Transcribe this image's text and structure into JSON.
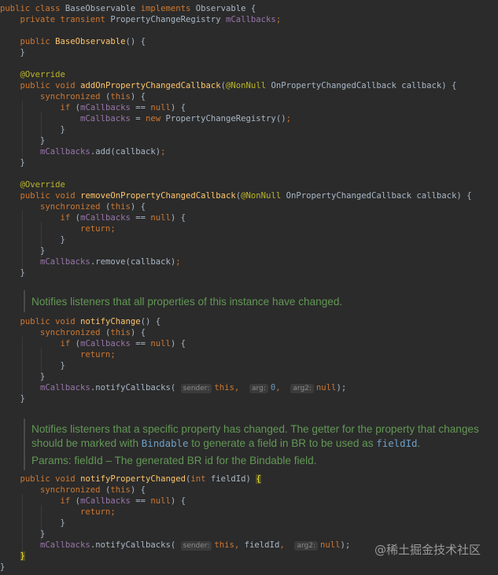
{
  "code": {
    "l1": [
      [
        "public class ",
        "kw"
      ],
      [
        "BaseObservable ",
        "plain"
      ],
      [
        "implements ",
        "kw"
      ],
      [
        "Observable {",
        "plain"
      ]
    ],
    "l2": [
      [
        "    private transient ",
        "kw"
      ],
      [
        "PropertyChangeRegistry ",
        "plain"
      ],
      [
        "mCallbacks",
        "fld"
      ],
      [
        ";",
        "kw"
      ]
    ],
    "l3": [
      [
        "    public ",
        "kw"
      ],
      [
        "BaseObservable",
        "fn"
      ],
      [
        "() {",
        "plain"
      ]
    ],
    "l4": [
      [
        "    }",
        "plain"
      ]
    ],
    "l5": [
      [
        "    @Override",
        "ann"
      ]
    ],
    "l6": [
      [
        "    public void ",
        "kw"
      ],
      [
        "addOnPropertyChangedCallback",
        "fn"
      ],
      [
        "(",
        "plain"
      ],
      [
        "@NonNull ",
        "ann"
      ],
      [
        "OnPropertyChangedCallback callback) {",
        "plain"
      ]
    ],
    "l7": [
      [
        "        synchronized ",
        "kw"
      ],
      [
        "(",
        "plain"
      ],
      [
        "this",
        "kw"
      ],
      [
        ") {",
        "plain"
      ]
    ],
    "l8": [
      [
        "            if ",
        "kw"
      ],
      [
        "(",
        "plain"
      ],
      [
        "mCallbacks ",
        "fld"
      ],
      [
        "== ",
        "plain"
      ],
      [
        "null",
        "kw"
      ],
      [
        ") {",
        "plain"
      ]
    ],
    "l9": [
      [
        "                mCallbacks ",
        "fld"
      ],
      [
        "= ",
        "plain"
      ],
      [
        "new ",
        "kw"
      ],
      [
        "PropertyChangeRegistry",
        "plain"
      ],
      [
        "()",
        "plain"
      ],
      [
        ";",
        "kw"
      ]
    ],
    "l10": [
      [
        "            }",
        "plain"
      ]
    ],
    "l11": [
      [
        "        }",
        "plain"
      ]
    ],
    "l12": [
      [
        "        mCallbacks",
        "fld"
      ],
      [
        ".add(callback)",
        "plain"
      ],
      [
        ";",
        "kw"
      ]
    ],
    "l13": [
      [
        "    }",
        "plain"
      ]
    ],
    "l14": [
      [
        "    @Override",
        "ann"
      ]
    ],
    "l15": [
      [
        "    public void ",
        "kw"
      ],
      [
        "removeOnPropertyChangedCallback",
        "fn"
      ],
      [
        "(",
        "plain"
      ],
      [
        "@NonNull ",
        "ann"
      ],
      [
        "OnPropertyChangedCallback callback) {",
        "plain"
      ]
    ],
    "l16": [
      [
        "        synchronized ",
        "kw"
      ],
      [
        "(",
        "plain"
      ],
      [
        "this",
        "kw"
      ],
      [
        ") {",
        "plain"
      ]
    ],
    "l17": [
      [
        "            if ",
        "kw"
      ],
      [
        "(",
        "plain"
      ],
      [
        "mCallbacks ",
        "fld"
      ],
      [
        "== ",
        "plain"
      ],
      [
        "null",
        "kw"
      ],
      [
        ") {",
        "plain"
      ]
    ],
    "l18": [
      [
        "                return",
        "kw"
      ],
      [
        ";",
        "kw"
      ]
    ],
    "l19": [
      [
        "            }",
        "plain"
      ]
    ],
    "l20": [
      [
        "        }",
        "plain"
      ]
    ],
    "l21": [
      [
        "        mCallbacks",
        "fld"
      ],
      [
        ".remove(callback)",
        "plain"
      ],
      [
        ";",
        "kw"
      ]
    ],
    "l22": [
      [
        "    }",
        "plain"
      ]
    ],
    "l23": [
      [
        "    public void ",
        "kw"
      ],
      [
        "notifyChange",
        "fn"
      ],
      [
        "() {",
        "plain"
      ]
    ],
    "l24": [
      [
        "        synchronized ",
        "kw"
      ],
      [
        "(",
        "plain"
      ],
      [
        "this",
        "kw"
      ],
      [
        ") {",
        "plain"
      ]
    ],
    "l25": [
      [
        "            if ",
        "kw"
      ],
      [
        "(",
        "plain"
      ],
      [
        "mCallbacks ",
        "fld"
      ],
      [
        "== ",
        "plain"
      ],
      [
        "null",
        "kw"
      ],
      [
        ") {",
        "plain"
      ]
    ],
    "l26": [
      [
        "                return",
        "kw"
      ],
      [
        ";",
        "kw"
      ]
    ],
    "l27": [
      [
        "            }",
        "plain"
      ]
    ],
    "l28": [
      [
        "        }",
        "plain"
      ]
    ],
    "l29": [
      [
        "        mCallbacks",
        "fld"
      ],
      [
        ".notifyCallbacks( ",
        "plain"
      ],
      [
        "#sender:",
        "hint"
      ],
      [
        "this",
        "kw"
      ],
      [
        ",  ",
        "kw"
      ],
      [
        "#arg:",
        "hint"
      ],
      [
        "0",
        "num"
      ],
      [
        ",  ",
        "kw"
      ],
      [
        "#arg2:",
        "hint"
      ],
      [
        "null",
        "kw"
      ],
      [
        ");",
        "plain"
      ]
    ],
    "l30": [
      [
        "    }",
        "plain"
      ]
    ],
    "l31": [
      [
        "    public void ",
        "kw"
      ],
      [
        "notifyPropertyChanged",
        "fn"
      ],
      [
        "(",
        "plain"
      ],
      [
        "int ",
        "kw"
      ],
      [
        "fieldId) ",
        "plain"
      ],
      [
        "{",
        "hl2"
      ]
    ],
    "l32": [
      [
        "        synchronized ",
        "kw"
      ],
      [
        "(",
        "plain"
      ],
      [
        "this",
        "kw"
      ],
      [
        ") {",
        "plain"
      ]
    ],
    "l33": [
      [
        "            if ",
        "kw"
      ],
      [
        "(",
        "plain"
      ],
      [
        "mCallbacks ",
        "fld"
      ],
      [
        "== ",
        "plain"
      ],
      [
        "null",
        "kw"
      ],
      [
        ") {",
        "plain"
      ]
    ],
    "l34": [
      [
        "                return",
        "kw"
      ],
      [
        ";",
        "kw"
      ]
    ],
    "l35": [
      [
        "            }",
        "plain"
      ]
    ],
    "l36": [
      [
        "        }",
        "plain"
      ]
    ],
    "l37": [
      [
        "        mCallbacks",
        "fld"
      ],
      [
        ".notifyCallbacks( ",
        "plain"
      ],
      [
        "#sender:",
        "hint"
      ],
      [
        "this",
        "kw"
      ],
      [
        ", ",
        "kw"
      ],
      [
        "fieldId",
        "plain"
      ],
      [
        ",  ",
        "kw"
      ],
      [
        "#arg2:",
        "hint"
      ],
      [
        "null",
        "kw"
      ],
      [
        ");",
        "plain"
      ]
    ],
    "l38": [
      [
        "    ",
        "plain"
      ],
      [
        "}",
        "hl2"
      ]
    ],
    "l39": [
      [
        "}",
        "plain"
      ]
    ]
  },
  "docs": {
    "notify_change": "Notifies listeners that all properties of this instance have changed.",
    "notify_property_line1": "Notifies listeners that a specific property has changed. The getter for the property that changes",
    "notify_property_line2_pre": "should be marked with ",
    "notify_property_line2_code1": "Bindable",
    "notify_property_line2_mid": " to generate a field in BR to be used as ",
    "notify_property_line2_code2": "fieldId",
    "notify_property_line2_post": ".",
    "notify_property_params": "Params: fieldId – The generated BR id for the Bindable field."
  },
  "watermark": "@稀土掘金技术社区",
  "colors": {
    "background": "#2b2b2b",
    "keyword": "#cc7832",
    "method": "#ffc66d",
    "annotation": "#bbb529",
    "field": "#9876aa",
    "number": "#6897bb",
    "doc_comment": "#629755"
  }
}
